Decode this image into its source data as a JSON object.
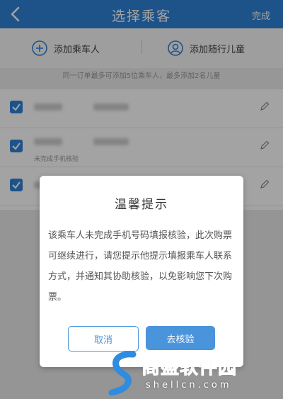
{
  "header": {
    "title": "选择乘客",
    "done_label": "完成"
  },
  "actions": {
    "add_passenger": "添加乘车人",
    "add_child": "添加随行儿童"
  },
  "notice": "同一订单最多可添加5位乘车人，最多添加2名儿童",
  "passengers": [
    {
      "checked": true
    },
    {
      "checked": true,
      "note": "未完成手机核验"
    },
    {
      "checked": true
    }
  ],
  "dialog": {
    "title": "温馨提示",
    "body": "该乘车人未完成手机号码填报核验，此次购票可继续进行，请您提示他提示填报乘车人联系方式，并通知其协助核验，以免影响您下次购票。",
    "cancel_label": "取消",
    "verify_label": "去核验"
  },
  "watermark": {
    "main": "商盛软件园",
    "sub": "shellcn.com"
  },
  "colors": {
    "primary": "#2f83d6",
    "button": "#4a94dc"
  }
}
